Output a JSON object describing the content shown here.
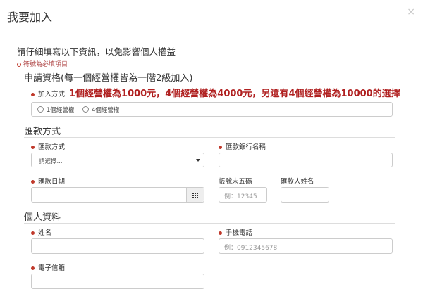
{
  "modal": {
    "title": "我要加入",
    "close_symbol": "×"
  },
  "intro": "請仔細填寫以下資訊，以免影響個人權益",
  "required_note": "符號為必填項目",
  "section_apply": {
    "title": "申請資格(每一個經營權皆為一階2級加入)",
    "join_label": "加入方式",
    "highlight": "1個經營權為1000元，4個經營權為4000元，另還有4個經營權為10000的選擇",
    "options": [
      "1個經營權",
      "4個經營權"
    ]
  },
  "section_remit": {
    "title": "匯款方式",
    "method_label": "匯款方式",
    "method_value": "請選擇...",
    "bank_label": "匯款銀行名稱",
    "date_label": "匯款日期",
    "account_label": "帳號末五碼",
    "account_placeholder": "例：12345",
    "remitter_label": "匯款人姓名"
  },
  "section_personal": {
    "title": "個人資料",
    "name_label": "姓名",
    "phone_label": "手機電話",
    "phone_placeholder": "例：0912345678",
    "email_label": "電子信箱"
  },
  "colors": {
    "required_red": "#c0392b",
    "highlight_red": "#b02020",
    "border": "#cccccc"
  },
  "icons": [
    "close-icon",
    "calendar-icon",
    "chevron-down-icon",
    "required-dot-icon"
  ]
}
